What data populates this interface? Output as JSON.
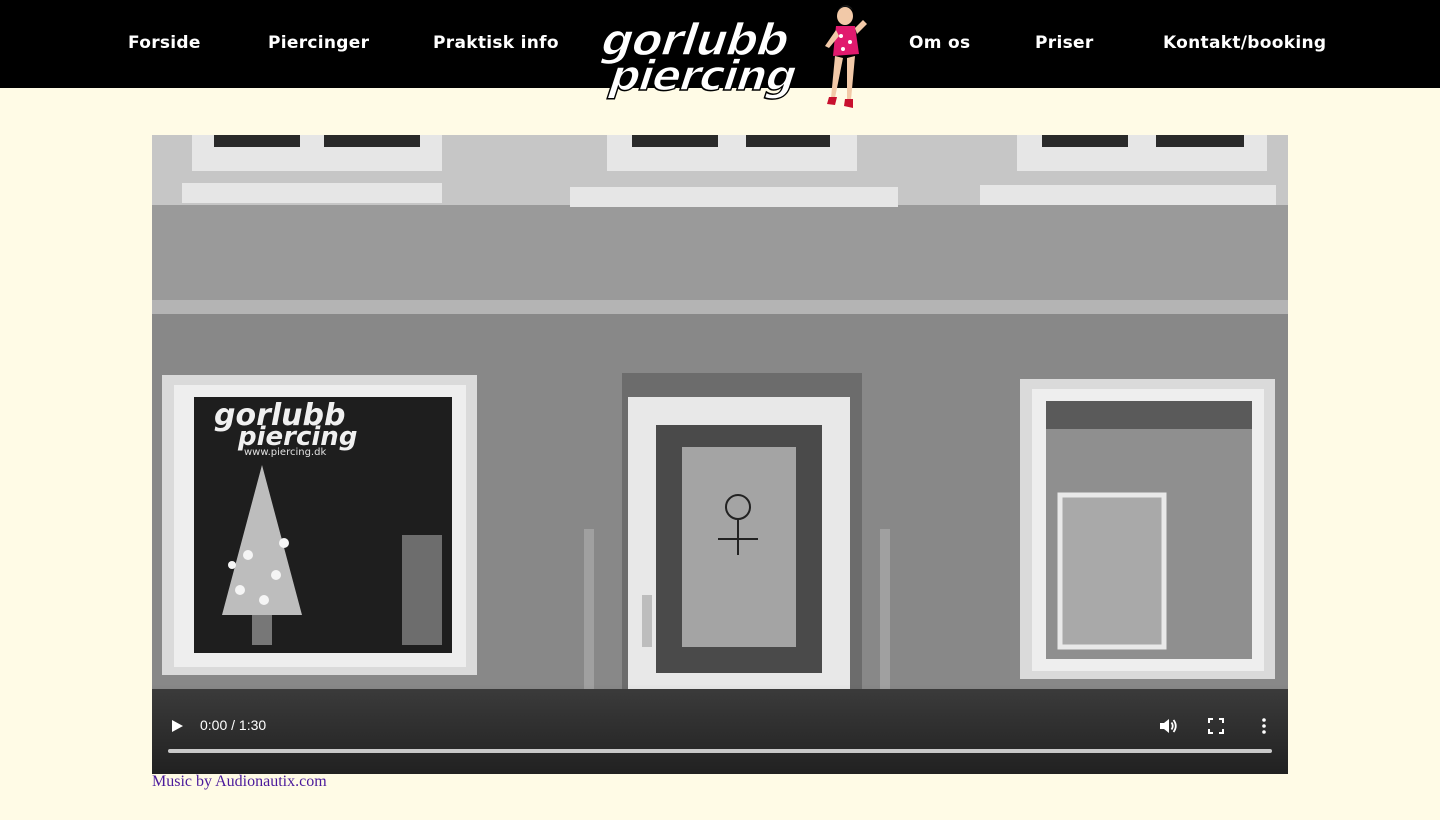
{
  "nav": {
    "items": [
      {
        "label": "Forside"
      },
      {
        "label": "Piercinger"
      },
      {
        "label": "Praktisk info"
      },
      {
        "label": "Om os"
      },
      {
        "label": "Priser"
      },
      {
        "label": "Kontakt/booking"
      }
    ]
  },
  "logo": {
    "line1": "gorlubb",
    "line2": "piercing"
  },
  "video": {
    "storefront_sign_line1": "gorlubb",
    "storefront_sign_line2": "piercing",
    "storefront_sign_url": "www.piercing.dk",
    "current_time": "0:00",
    "duration": "1:30",
    "time_display": "0:00 / 1:30",
    "progress": 0
  },
  "caption": {
    "text": "Music by Audionautix.com"
  },
  "colors": {
    "background": "#fffbe6",
    "header": "#000000",
    "nav_text": "#ffffff",
    "caption_link": "#4b1a9c"
  }
}
